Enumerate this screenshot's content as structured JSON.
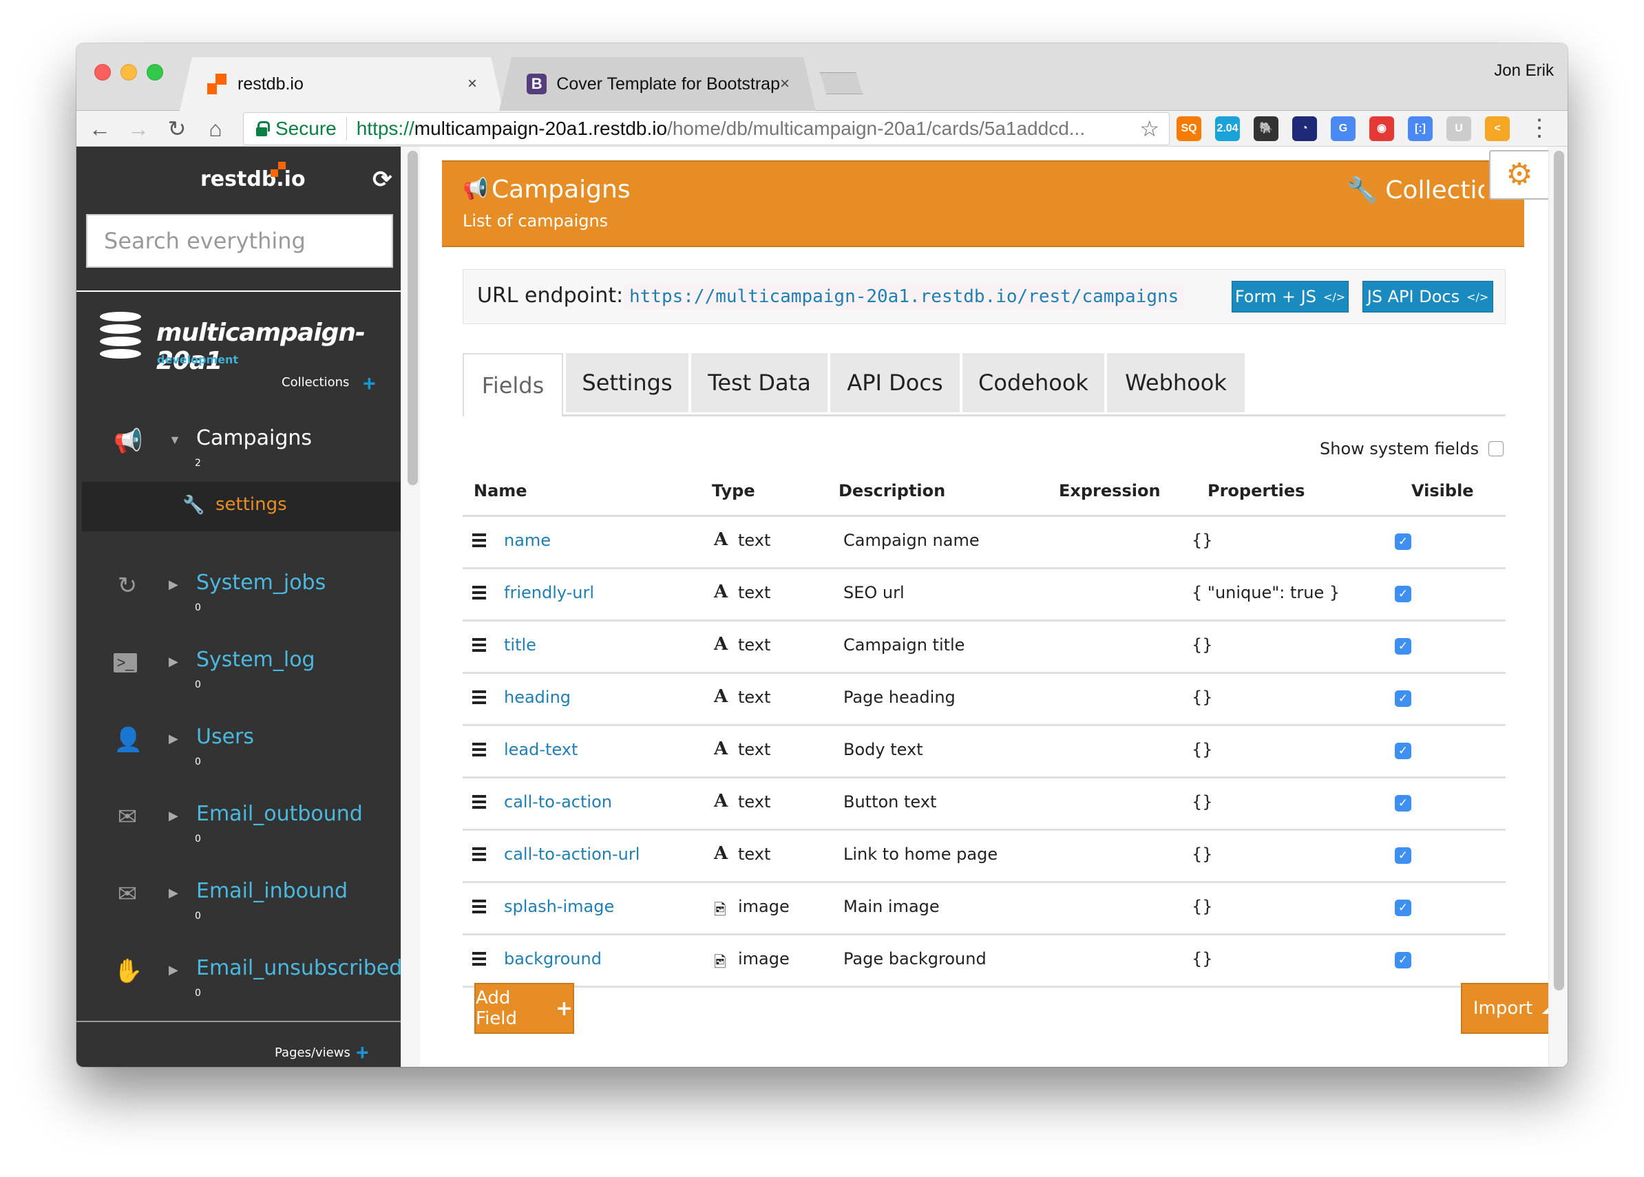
{
  "browser": {
    "tabs": [
      {
        "title": "restdb.io",
        "favicon": "restdb-logo",
        "active": true,
        "close": "×"
      },
      {
        "title": "Cover Template for Bootstrap",
        "favicon": "bootstrap-logo",
        "active": false,
        "close": "×"
      }
    ],
    "bootstrap_favicon_letter": "B",
    "user": "Jon Erik",
    "nav": {
      "back": "←",
      "forward": "→",
      "reload": "↻",
      "home": "⌂"
    },
    "address": {
      "secure_label": "Secure",
      "scheme": "https://",
      "host": "multicampaign-20a1.restdb.io",
      "path": "/home/db/multicampaign-20a1/cards/5a1addcd..."
    },
    "bookmark_star": "☆",
    "extensions": [
      {
        "name": "sq-extension",
        "label": "SQ",
        "color": "#f57c00"
      },
      {
        "name": "badge-extension",
        "label": "2.04",
        "color": "#1aa3d9"
      },
      {
        "name": "evernote-extension",
        "label": "🐘",
        "color": "#333333"
      },
      {
        "name": "speedometer-extension",
        "label": "◔",
        "color": "#1e2a78"
      },
      {
        "name": "google-translate-extension",
        "label": "G",
        "color": "#4a89f3"
      },
      {
        "name": "color-picker-extension",
        "label": "◉",
        "color": "#e53935"
      },
      {
        "name": "tag-extension",
        "label": "[:]",
        "color": "#4a89f3"
      },
      {
        "name": "u-extension",
        "label": "U",
        "color": "#cccccc"
      },
      {
        "name": "share-extension",
        "label": "<",
        "color": "#f5a623"
      }
    ],
    "menu": "⋮"
  },
  "sidebar": {
    "logo": "restdb.io",
    "refresh_icon": "⟳",
    "search_placeholder": "Search everything",
    "database": {
      "name": "multicampaign-20a1",
      "env": "development"
    },
    "collections_label": "Collections",
    "pages_label": "Pages/views",
    "plus": "+",
    "items": [
      {
        "label": "Campaigns",
        "count": "2",
        "icon": "📢",
        "caret": "▼",
        "open": true
      },
      {
        "label": "System_jobs",
        "count": "0",
        "icon": "↻",
        "caret": "▶",
        "open": false
      },
      {
        "label": "System_log",
        "count": "0",
        "icon": ">_",
        "caret": "▶",
        "open": false
      },
      {
        "label": "Users",
        "count": "0",
        "icon": "👤",
        "caret": "▶",
        "open": false
      },
      {
        "label": "Email_outbound",
        "count": "0",
        "icon": "✉",
        "caret": "▶",
        "open": false
      },
      {
        "label": "Email_inbound",
        "count": "0",
        "icon": "✉",
        "caret": "▶",
        "open": false
      },
      {
        "label": "Email_unsubscribed",
        "count": "0",
        "icon": "✋",
        "caret": "▶",
        "open": false
      }
    ],
    "sub_item": {
      "label": "settings",
      "icon": "🔧"
    }
  },
  "header": {
    "icon": "📢",
    "title": "Campaigns",
    "subtitle": "List of campaigns",
    "right_label": "Collection",
    "right_icon": "🔧",
    "gear_icon": "⚙"
  },
  "endpoint": {
    "label": "URL endpoint:",
    "url": "https://multicampaign-20a1.restdb.io/rest/campaigns",
    "buttons": [
      {
        "label": "Form + JS",
        "icon": "</>"
      },
      {
        "label": "JS API Docs",
        "icon": "</>"
      }
    ]
  },
  "tabs": [
    {
      "label": "Fields",
      "active": true
    },
    {
      "label": "Settings",
      "active": false
    },
    {
      "label": "Test Data",
      "active": false
    },
    {
      "label": "API Docs",
      "active": false
    },
    {
      "label": "Codehook",
      "active": false
    },
    {
      "label": "Webhook",
      "active": false
    }
  ],
  "show_system_fields": {
    "label": "Show system fields",
    "checked": false
  },
  "table": {
    "columns": [
      "Name",
      "Type",
      "Description",
      "Expression",
      "Properties",
      "Visible"
    ],
    "rows": [
      {
        "name": "name",
        "type": "text",
        "type_icon": "A",
        "description": "Campaign name",
        "expression": "",
        "properties": "{}",
        "visible": true
      },
      {
        "name": "friendly-url",
        "type": "text",
        "type_icon": "A",
        "description": "SEO url",
        "expression": "",
        "properties": "{ \"unique\": true }",
        "visible": true
      },
      {
        "name": "title",
        "type": "text",
        "type_icon": "A",
        "description": "Campaign title",
        "expression": "",
        "properties": "{}",
        "visible": true
      },
      {
        "name": "heading",
        "type": "text",
        "type_icon": "A",
        "description": "Page heading",
        "expression": "",
        "properties": "{}",
        "visible": true
      },
      {
        "name": "lead-text",
        "type": "text",
        "type_icon": "A",
        "description": "Body text",
        "expression": "",
        "properties": "{}",
        "visible": true
      },
      {
        "name": "call-to-action",
        "type": "text",
        "type_icon": "A",
        "description": "Button text",
        "expression": "",
        "properties": "{}",
        "visible": true
      },
      {
        "name": "call-to-action-url",
        "type": "text",
        "type_icon": "A",
        "description": "Link to home page",
        "expression": "",
        "properties": "{}",
        "visible": true
      },
      {
        "name": "splash-image",
        "type": "image",
        "type_icon": "🖻",
        "description": "Main image",
        "expression": "",
        "properties": "{}",
        "visible": true
      },
      {
        "name": "background",
        "type": "image",
        "type_icon": "🖻",
        "description": "Page background",
        "expression": "",
        "properties": "{}",
        "visible": true
      }
    ]
  },
  "actions": {
    "add_field": {
      "label": "Add Field",
      "icon": "+"
    },
    "import": {
      "label": "Import",
      "icon": "☁"
    }
  },
  "colors": {
    "accent_orange": "#e68e25",
    "link_blue": "#1f7fb3",
    "sidebar_bg": "#333333",
    "button_blue": "#1a8bc0",
    "checkbox_blue": "#3d8ff0"
  }
}
